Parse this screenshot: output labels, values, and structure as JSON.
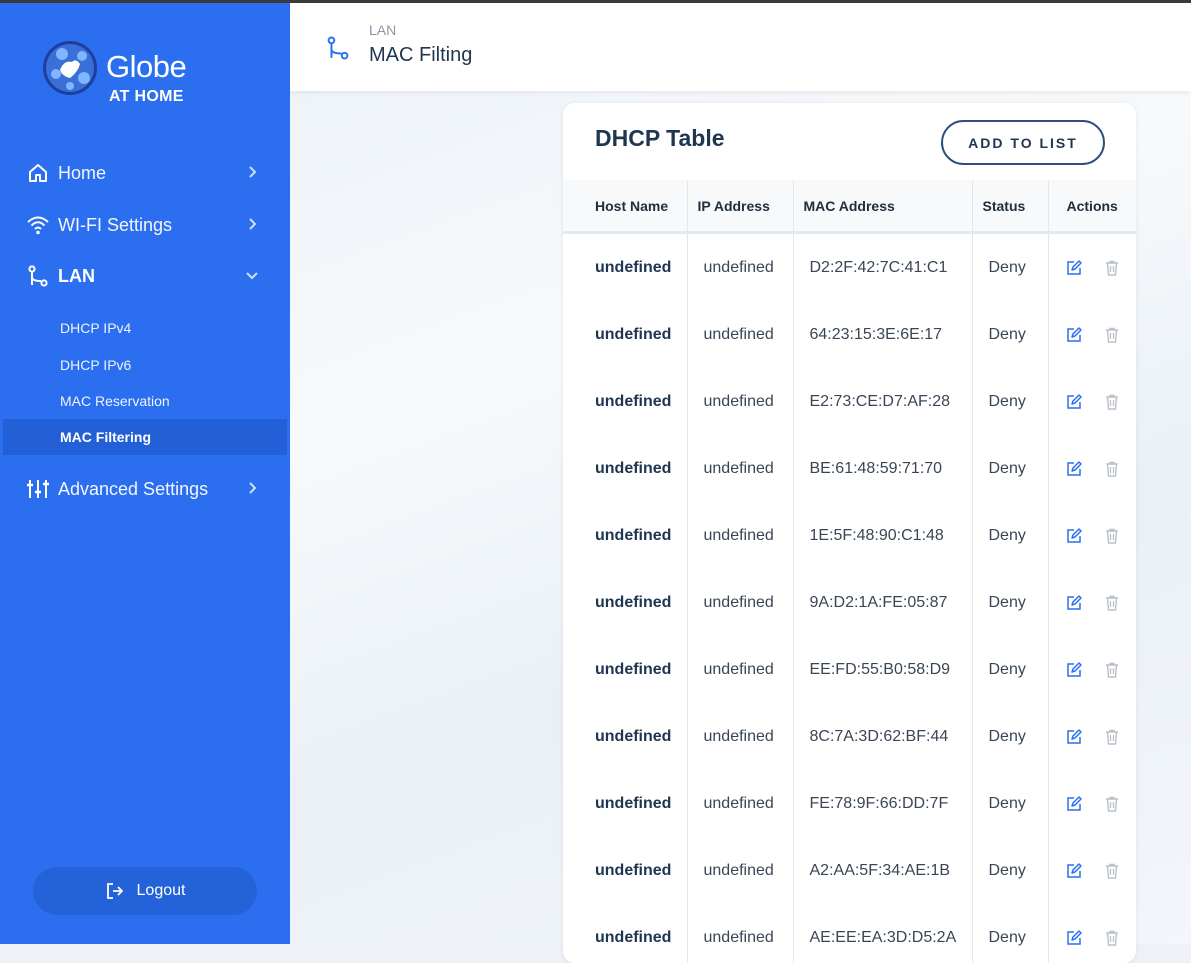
{
  "brand": {
    "name": "Globe",
    "sub": "AT HOME"
  },
  "nav": {
    "home": "Home",
    "wifi": "WI-FI Settings",
    "lan": "LAN",
    "lan_items": [
      "DHCP IPv4",
      "DHCP IPv6",
      "MAC Reservation",
      "MAC Filtering"
    ],
    "advanced": "Advanced Settings",
    "logout": "Logout"
  },
  "header": {
    "breadcrumb": "LAN",
    "title": "MAC Filting"
  },
  "card": {
    "title": "DHCP Table",
    "add_button": "ADD TO LIST"
  },
  "table": {
    "columns": [
      "Host Name",
      "IP Address",
      "MAC Address",
      "Status",
      "Actions"
    ],
    "rows": [
      {
        "host": "undefined",
        "ip": "undefined",
        "mac": "D2:2F:42:7C:41:C1",
        "status": "Deny"
      },
      {
        "host": "undefined",
        "ip": "undefined",
        "mac": "64:23:15:3E:6E:17",
        "status": "Deny"
      },
      {
        "host": "undefined",
        "ip": "undefined",
        "mac": "E2:73:CE:D7:AF:28",
        "status": "Deny"
      },
      {
        "host": "undefined",
        "ip": "undefined",
        "mac": "BE:61:48:59:71:70",
        "status": "Deny"
      },
      {
        "host": "undefined",
        "ip": "undefined",
        "mac": "1E:5F:48:90:C1:48",
        "status": "Deny"
      },
      {
        "host": "undefined",
        "ip": "undefined",
        "mac": "9A:D2:1A:FE:05:87",
        "status": "Deny"
      },
      {
        "host": "undefined",
        "ip": "undefined",
        "mac": "EE:FD:55:B0:58:D9",
        "status": "Deny"
      },
      {
        "host": "undefined",
        "ip": "undefined",
        "mac": "8C:7A:3D:62:BF:44",
        "status": "Deny"
      },
      {
        "host": "undefined",
        "ip": "undefined",
        "mac": "FE:78:9F:66:DD:7F",
        "status": "Deny"
      },
      {
        "host": "undefined",
        "ip": "undefined",
        "mac": "A2:AA:5F:34:AE:1B",
        "status": "Deny"
      },
      {
        "host": "undefined",
        "ip": "undefined",
        "mac": "AE:EE:EA:3D:D5:2A",
        "status": "Deny"
      }
    ]
  },
  "icons": {
    "home": "home-icon",
    "wifi": "wifi-icon",
    "lan": "lan-icon",
    "advanced": "sliders-icon",
    "logout": "logout-icon",
    "edit": "edit-icon",
    "delete": "trash-icon"
  },
  "colors": {
    "sidebar": "#2b6ff0",
    "accent": "#2b6ff0",
    "title": "#1f3550"
  }
}
